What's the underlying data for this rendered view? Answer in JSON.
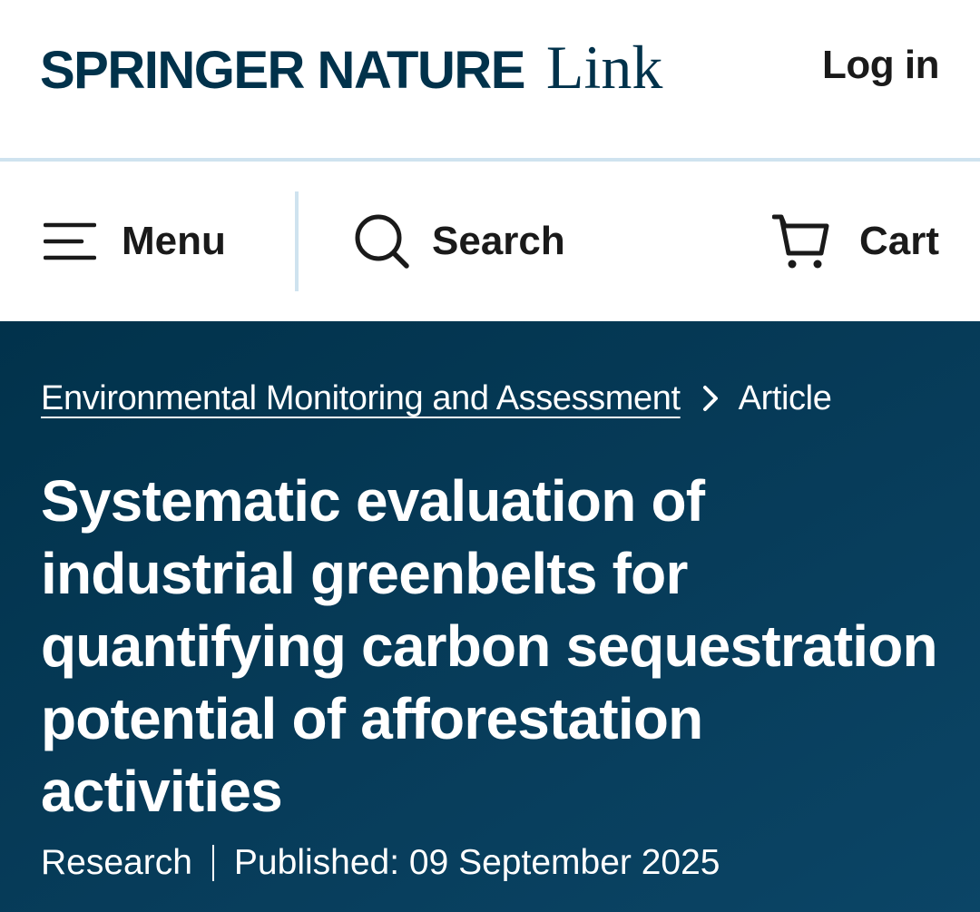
{
  "header": {
    "brand_primary": "Springer Nature",
    "brand_secondary": "Link",
    "login_label": "Log in"
  },
  "nav": {
    "menu_label": "Menu",
    "search_label": "Search",
    "cart_label": "Cart"
  },
  "breadcrumb": {
    "journal": "Environmental Monitoring and Assessment",
    "current": "Article"
  },
  "article": {
    "title": "Systematic evaluation of industrial greenbelts for quantifying carbon sequestration potential of afforestation activities",
    "type": "Research",
    "published": "Published: 09 September 2025"
  },
  "colors": {
    "brand_navy": "#01324b",
    "hero_background": "#063a57",
    "divider": "#cfe3ef",
    "text_dark": "#1a1a1a"
  },
  "icons": {
    "menu": "hamburger-icon",
    "search": "search-icon",
    "cart": "cart-icon",
    "breadcrumb_separator": "chevron-right-icon"
  }
}
